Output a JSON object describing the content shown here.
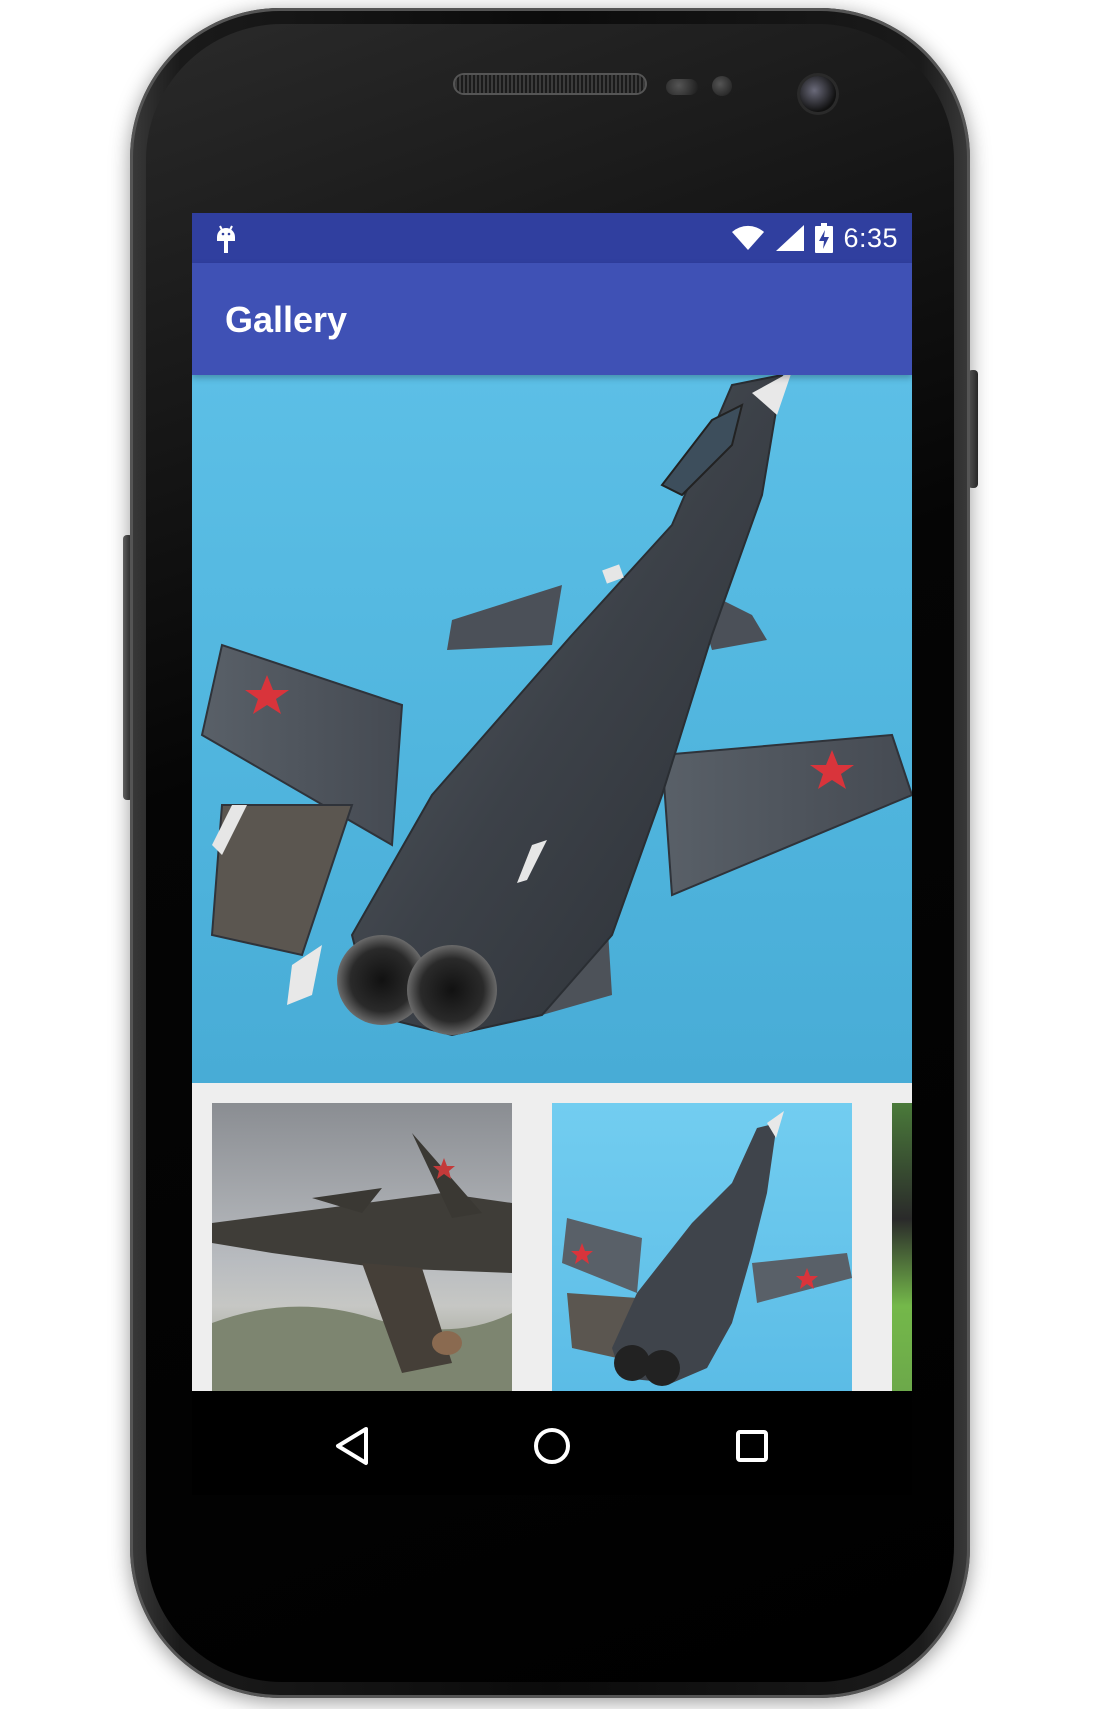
{
  "status_bar": {
    "time": "6:35",
    "icons": [
      "android-debug-icon",
      "wifi-icon",
      "signal-icon",
      "battery-charging-icon"
    ],
    "color": "#303f9f"
  },
  "app_bar": {
    "title": "Gallery",
    "color": "#3f51b5"
  },
  "gallery": {
    "main_image": "fighter-jet-photo",
    "thumbnails": [
      "fighter-jet-painting",
      "fighter-jet-photo",
      "fighter-jet-on-grass"
    ]
  },
  "nav_bar": {
    "buttons": [
      "back-icon",
      "home-icon",
      "recents-icon"
    ]
  },
  "device": {
    "body_color": "#0b0b0b"
  }
}
